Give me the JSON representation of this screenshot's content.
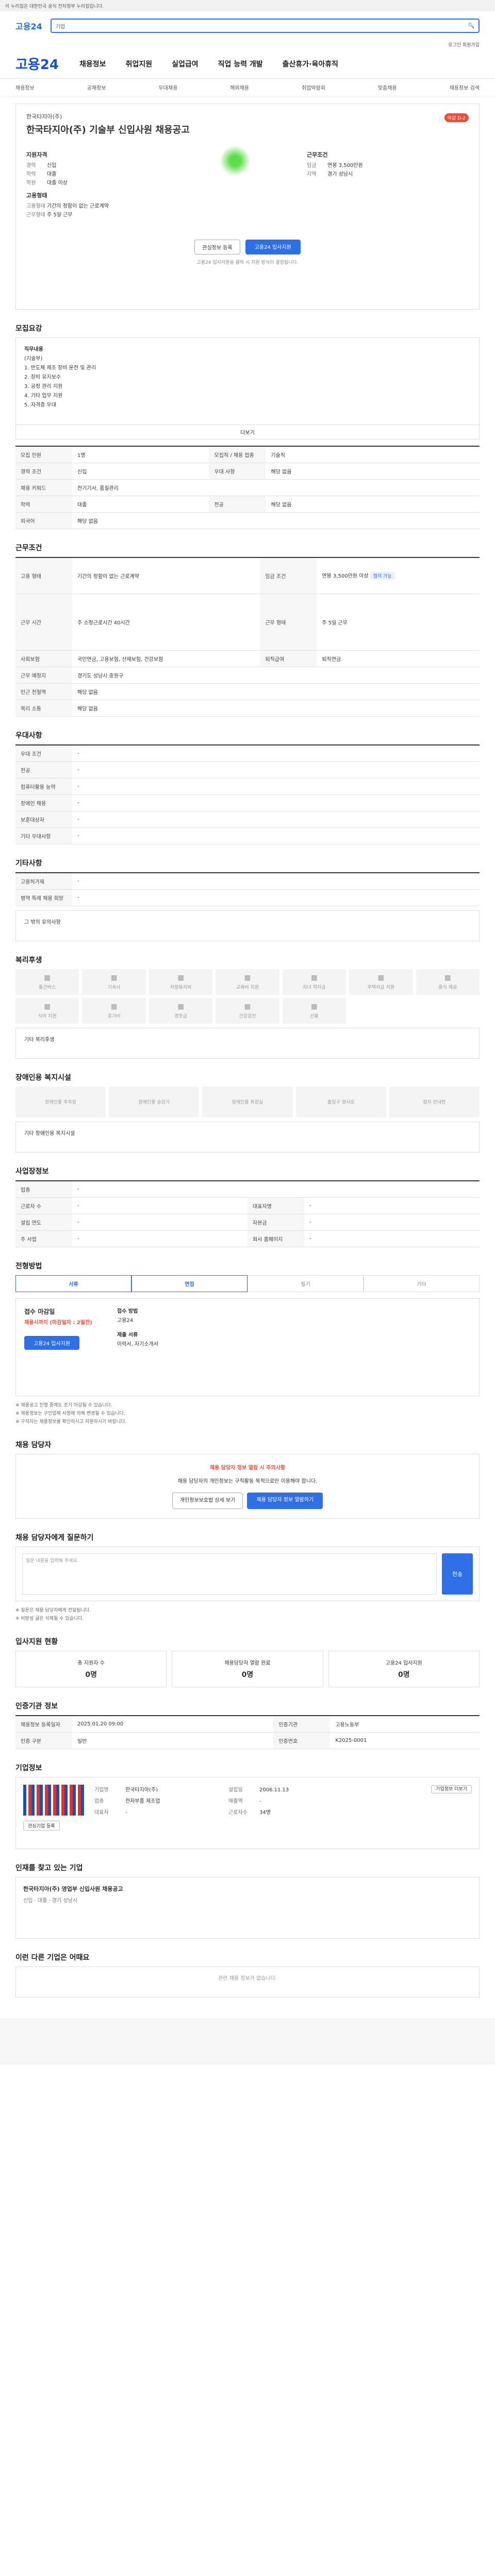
{
  "gov_bar": "이 누리집은 대한민국 공식 전자정부 누리집입니다.",
  "search": {
    "logo": "고용24",
    "placeholder": "기업"
  },
  "util": "로그인  회원가입",
  "gnb": {
    "logo": "고용24",
    "items": [
      "채용정보",
      "취업지원",
      "실업급여",
      "직업 능력 개발",
      "출산휴가·육아휴직"
    ]
  },
  "lnb": [
    "채용정보",
    "공채정보",
    "우대채용",
    "해외채용",
    "취업박람회",
    "맞춤채용",
    "채용정보 검색"
  ],
  "job": {
    "company": "한국타지아(주)",
    "title": "한국타지아(주) 기술부 신입사원 채용공고",
    "badge": "마감 D-2",
    "left_h": "지원자격",
    "left": [
      [
        "경력",
        "신입"
      ],
      [
        "학력",
        "대졸"
      ],
      [
        "학원",
        "대졸 이상"
      ]
    ],
    "mid_h": "고용형태",
    "mid": [
      [
        "고용형태",
        "기간의 정함이 없는 근로계약"
      ],
      [
        "근무형태",
        "주 5일 근무"
      ]
    ],
    "right_h": "근무조건",
    "right": [
      [
        "임금",
        "연봉 3,500만원"
      ],
      [
        "지역",
        "경기 성남시"
      ]
    ],
    "btn_save": "관심정보 등록",
    "btn_apply": "고용24 입사지원",
    "note": "고용24 입사지원을 클릭 시 지원 방식이 결정됩니다."
  },
  "sections": {
    "detail": "모집요강",
    "work": "근무조건",
    "pref": "우대사항",
    "etc": "기타사항",
    "welfare": "복리후생",
    "disabled": "장애인용 복지시설",
    "workplace": "사업장정보",
    "process": "전형방법",
    "contact": "채용 담당자",
    "qa": "채용 담당자에게 질문하기",
    "status": "입사지원 현황",
    "agency": "인증기관 정보",
    "company": "기업정보",
    "other": "인재를 찾고 있는 기업",
    "similar": "이런 다른 기업은 어때요"
  },
  "detail_text": [
    "직무내용",
    "(기술부)",
    "1. 반도체 제조 장비 운전 및 관리",
    "2. 장비 유지보수",
    "3. 공정 관리 지원",
    "4. 기타 업무 지원",
    "5. 자격증 우대"
  ],
  "detail_more": "더보기",
  "info_rows": [
    [
      "모집 인원",
      "1명",
      "모집직 / 채용 업종",
      "기술직"
    ],
    [
      "경력 조건",
      "신입",
      "우대 사항",
      "해당 없음"
    ],
    [
      "채용 키워드",
      "전기기사, 품질관리",
      "",
      ""
    ],
    [
      "학력",
      "대졸",
      "전공",
      "해당 없음"
    ],
    [
      "외국어",
      "해당 없음",
      "",
      ""
    ]
  ],
  "work_rows": [
    [
      "고용 형태",
      "기간의 정함이 없는 근로계약",
      "임금 조건",
      "연봉 3,500만원 이상"
    ],
    [
      "근무 시간",
      "주 소정근로시간 40시간",
      "근무 형태",
      "주 5일 근무"
    ],
    [
      "사회보험",
      "국민연금, 고용보험, 산재보험, 건강보험",
      "퇴직급여",
      "퇴직연금"
    ],
    [
      "근무 예정지",
      "경기도 성남시 중원구",
      "",
      ""
    ],
    [
      "인근 전철역",
      "해당 없음",
      "",
      ""
    ],
    [
      "복리 소통",
      "해당 없음",
      "",
      ""
    ]
  ],
  "work_tag": "협의 가능",
  "pref_rows": [
    [
      "우대 조건",
      "-"
    ],
    [
      "전공",
      "-"
    ],
    [
      "컴퓨터활용 능력",
      "-"
    ],
    [
      "장애인 채용",
      "-"
    ],
    [
      "보훈대상자",
      "-"
    ],
    [
      "기타 우대사항",
      "-"
    ]
  ],
  "etc_rows": [
    [
      "고용허가제",
      "-"
    ],
    [
      "병역 특례 채용 희망",
      "-"
    ]
  ],
  "etc_note": "그 밖의 유의사항",
  "welfare_items": [
    "통근버스",
    "기숙사",
    "차량유지비",
    "교육비 지원",
    "자녀 학자금",
    "주택자금 지원",
    "중식 제공",
    "식비 지원",
    "휴가비",
    "경조금",
    "건강검진",
    "선물",
    "",
    ""
  ],
  "welfare_note": "기타 복리후생",
  "disabled_items": [
    "장애인용 주차장",
    "장애인용 승강기",
    "장애인용 화장실",
    "출입구 경사로",
    "점자 안내판"
  ],
  "disabled_note": "기타 장애인용 복지시설",
  "workplace_rows": [
    [
      "업종",
      "-",
      "",
      ""
    ],
    [
      "근로자 수",
      "-",
      "대표자명",
      "-"
    ],
    [
      "설립 연도",
      "-",
      "자본금",
      "-"
    ],
    [
      "주 사업",
      "-",
      "회사 홈페이지",
      "-"
    ]
  ],
  "process_tabs": [
    "서류",
    "면접",
    "필기",
    "기타"
  ],
  "apply": {
    "period_h": "접수 마감일",
    "period": "채용시까지 (마감일자 : 2일전)",
    "method_h": "접수 방법",
    "method": "고용24",
    "doc_h": "제출 서류",
    "doc": "이력서, 자기소개서",
    "btn": "고용24 입사지원"
  },
  "apply_notes": [
    "※ 채용공고 진행 중에도 조기 마감될 수 있습니다.",
    "※ 채용정보는 구인업체 사정에 의해 변경될 수 있습니다.",
    "※ 구직자는 채용정보를 확인하시고 지원하시기 바랍니다."
  ],
  "contact": {
    "warn": "채용 담당자 정보 열람 시 주의사항",
    "text": "채용 담당자의 개인정보는 구직활동 목적으로만 이용해야 합니다.",
    "btn1": "개인정보보호법 상세 보기",
    "btn2": "채용 담당자 정보 열람하기"
  },
  "qa": {
    "placeholder": "질문 내용을 입력해 주세요.",
    "btn": "전송",
    "notes": [
      "※ 질문은 채용 담당자에게 전달됩니다.",
      "※ 비방성 글은 삭제될 수 있습니다."
    ]
  },
  "status": [
    [
      "총 지원자 수",
      "0명"
    ],
    [
      "채용담당자 열람 완료",
      "0명"
    ],
    [
      "고용24 입사지원",
      "0명"
    ]
  ],
  "agency_rows": [
    [
      "채용정보 등록일자",
      "2025.01.20 09:00",
      "인증기관",
      "고용노동부"
    ],
    [
      "인증 구분",
      "일반",
      "인증번호",
      "K2025-0001"
    ]
  ],
  "company_info": {
    "btn1": "관심기업 등록",
    "btn2": "기업정보 더보기",
    "rows": [
      [
        "기업명",
        "한국타지아(주)",
        "설립일",
        "2006.11.13"
      ],
      [
        "업종",
        "전자부품 제조업",
        "매출액",
        "-"
      ],
      [
        "대표자",
        "-",
        "근로자수",
        "34명"
      ]
    ]
  },
  "other": {
    "name": "한국타지아(주) 영업부 신입사원 채용공고",
    "tags": "신입 · 대졸 · 경기 성남시"
  },
  "similar_empty": "관련 채용 정보가 없습니다."
}
